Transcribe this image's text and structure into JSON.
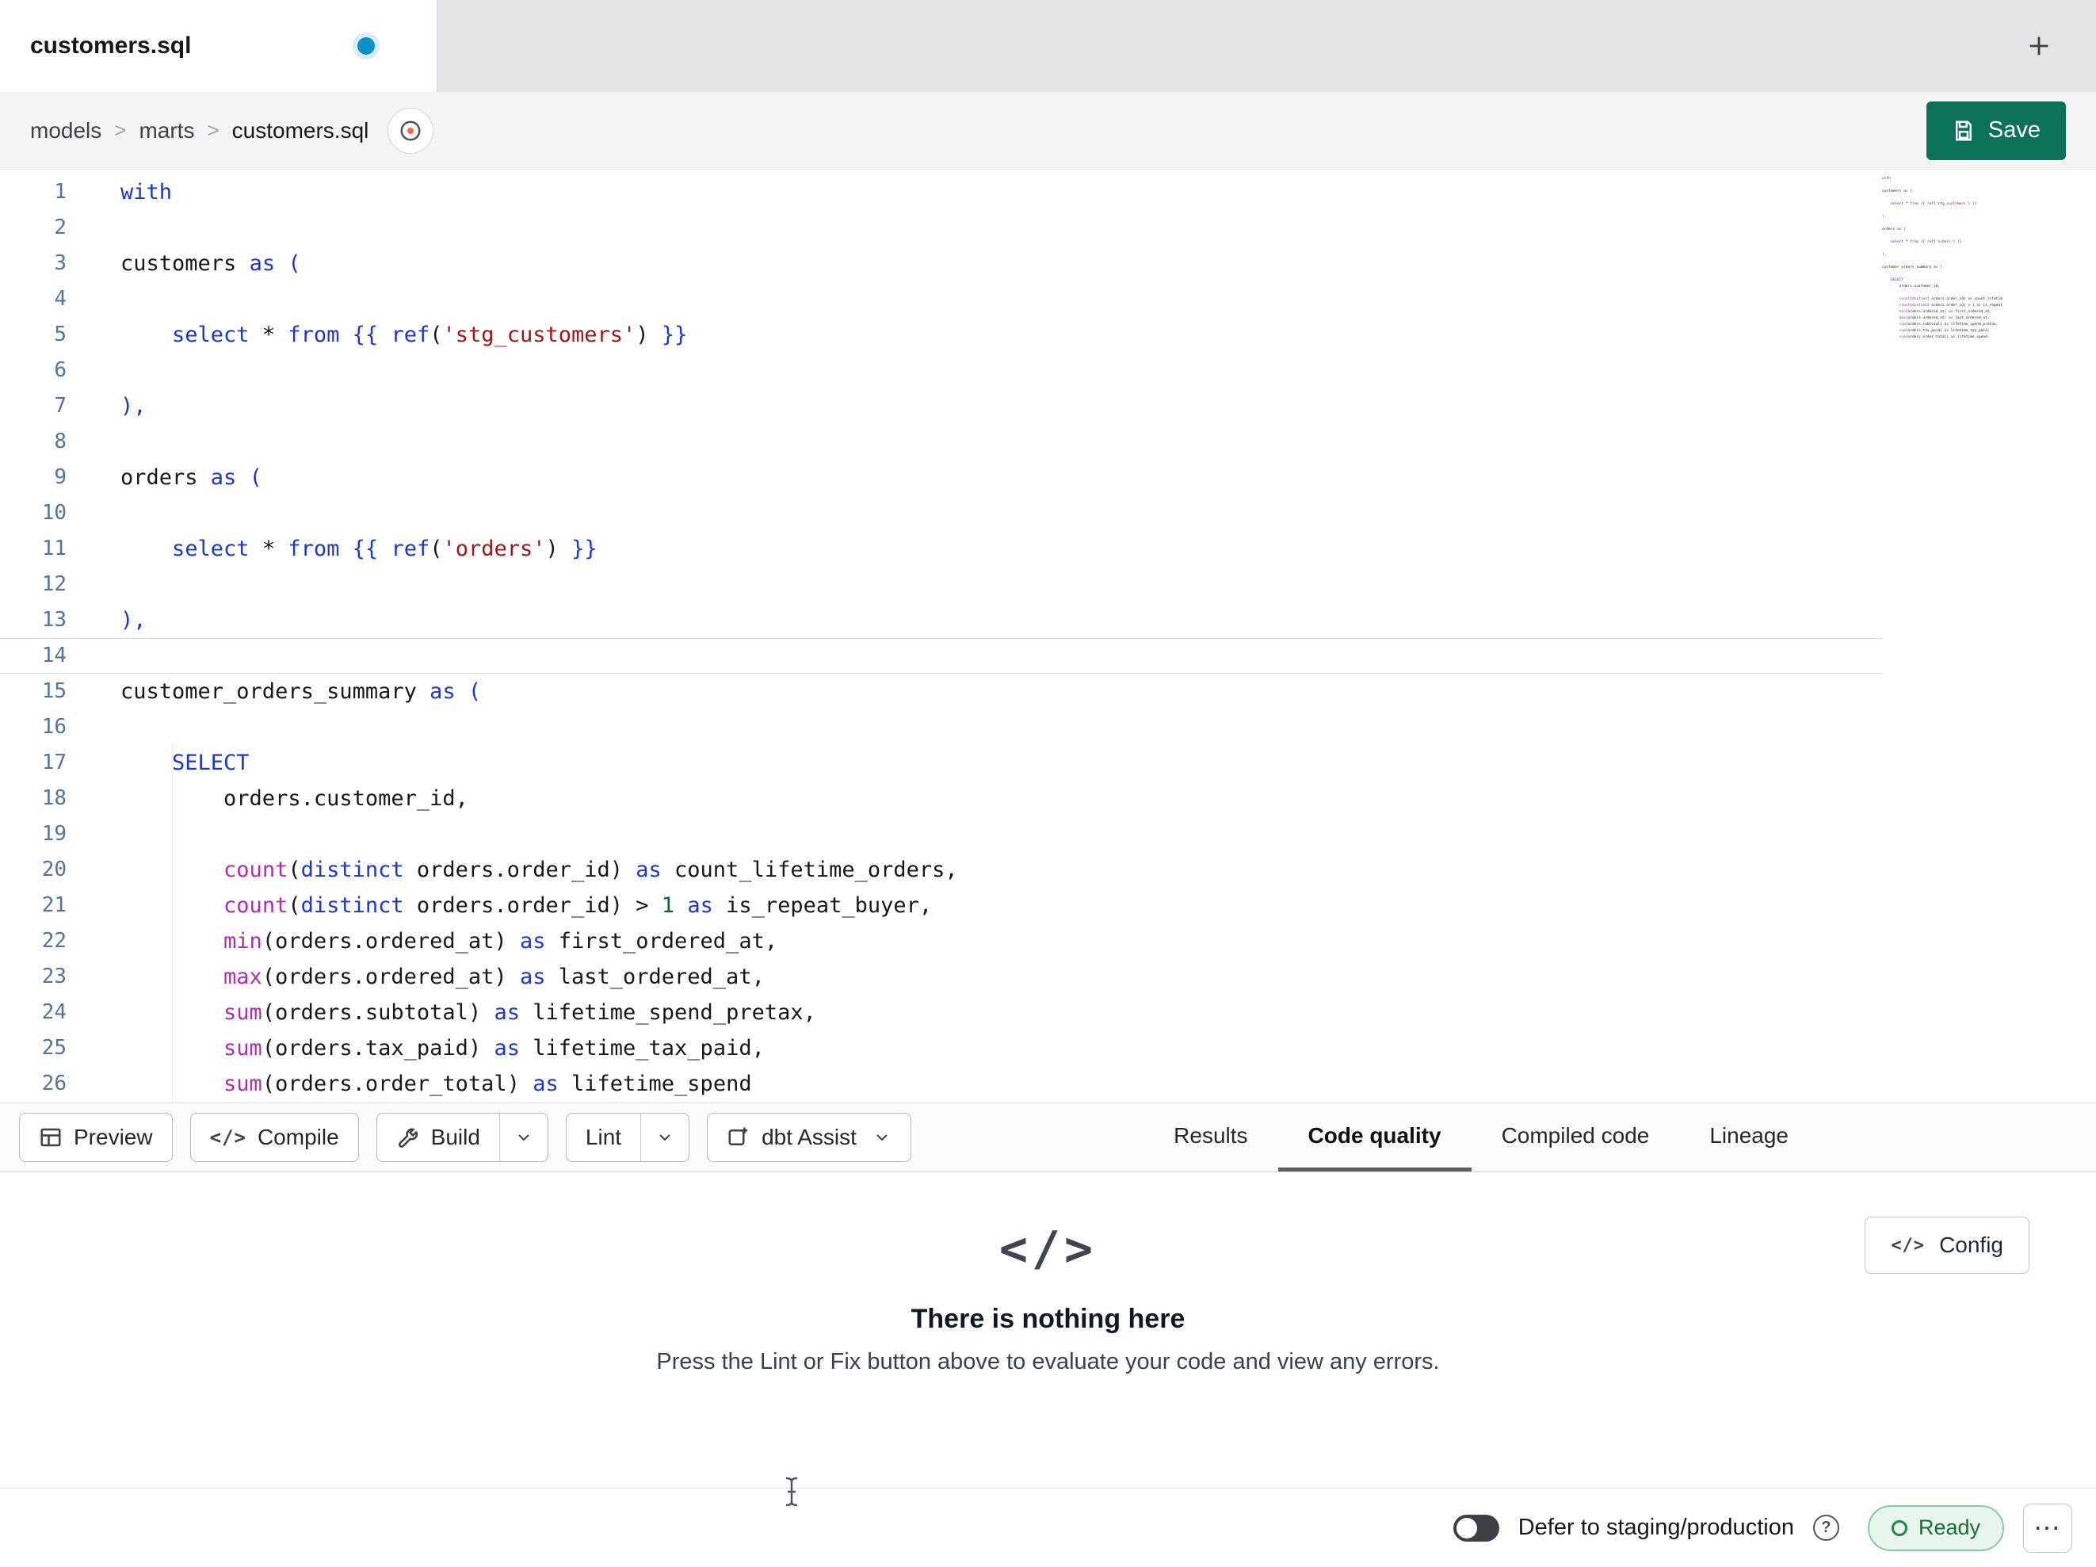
{
  "window": {
    "tab_title": "customers.sql",
    "tab_modified": true,
    "new_tab_icon": "plus-icon"
  },
  "breadcrumb": {
    "items": [
      "models",
      "marts",
      "customers.sql"
    ],
    "separator": ">",
    "docs_icon": "docs-circle-icon"
  },
  "save": {
    "label": "Save",
    "icon": "save-floppy-icon",
    "color": "#0b7258"
  },
  "editor": {
    "language": "sql",
    "current_line": 14,
    "lines": [
      {
        "num": 1,
        "tokens": [
          [
            "kw",
            "with"
          ]
        ]
      },
      {
        "num": 2,
        "tokens": []
      },
      {
        "num": 3,
        "tokens": [
          [
            "id",
            "customers "
          ],
          [
            "kw",
            "as"
          ],
          [
            "id",
            " "
          ],
          [
            "brk",
            "("
          ]
        ]
      },
      {
        "num": 4,
        "tokens": []
      },
      {
        "num": 5,
        "tokens": [
          [
            "id",
            "    "
          ],
          [
            "kw",
            "select"
          ],
          [
            "id",
            " * "
          ],
          [
            "kw",
            "from"
          ],
          [
            "id",
            " "
          ],
          [
            "tmpl",
            "{{"
          ],
          [
            "id",
            " "
          ],
          [
            "kw",
            "ref"
          ],
          [
            "punc",
            "("
          ],
          [
            "str",
            "'stg_customers'"
          ],
          [
            "punc",
            ")"
          ],
          [
            "id",
            " "
          ],
          [
            "tmpl",
            "}}"
          ]
        ]
      },
      {
        "num": 6,
        "tokens": []
      },
      {
        "num": 7,
        "tokens": [
          [
            "brk",
            "),"
          ]
        ]
      },
      {
        "num": 8,
        "tokens": []
      },
      {
        "num": 9,
        "tokens": [
          [
            "id",
            "orders "
          ],
          [
            "kw",
            "as"
          ],
          [
            "id",
            " "
          ],
          [
            "brk",
            "("
          ]
        ]
      },
      {
        "num": 10,
        "tokens": []
      },
      {
        "num": 11,
        "tokens": [
          [
            "id",
            "    "
          ],
          [
            "kw",
            "select"
          ],
          [
            "id",
            " * "
          ],
          [
            "kw",
            "from"
          ],
          [
            "id",
            " "
          ],
          [
            "tmpl",
            "{{"
          ],
          [
            "id",
            " "
          ],
          [
            "kw",
            "ref"
          ],
          [
            "punc",
            "("
          ],
          [
            "str",
            "'orders'"
          ],
          [
            "punc",
            ")"
          ],
          [
            "id",
            " "
          ],
          [
            "tmpl",
            "}}"
          ]
        ]
      },
      {
        "num": 12,
        "tokens": []
      },
      {
        "num": 13,
        "tokens": [
          [
            "brk",
            "),"
          ]
        ]
      },
      {
        "num": 14,
        "tokens": []
      },
      {
        "num": 15,
        "tokens": [
          [
            "id",
            "customer_orders_summary "
          ],
          [
            "kw",
            "as"
          ],
          [
            "id",
            " "
          ],
          [
            "brk",
            "("
          ]
        ]
      },
      {
        "num": 16,
        "tokens": []
      },
      {
        "num": 17,
        "tokens": [
          [
            "id",
            "    "
          ],
          [
            "kw",
            "SELECT"
          ]
        ]
      },
      {
        "num": 18,
        "tokens": [
          [
            "id",
            "        orders.customer_id,"
          ]
        ]
      },
      {
        "num": 19,
        "tokens": []
      },
      {
        "num": 20,
        "tokens": [
          [
            "id",
            "        "
          ],
          [
            "fn",
            "count"
          ],
          [
            "punc",
            "("
          ],
          [
            "kw",
            "distinct"
          ],
          [
            "id",
            " orders.order_id"
          ],
          [
            "punc",
            ")"
          ],
          [
            "id",
            " "
          ],
          [
            "kw",
            "as"
          ],
          [
            "id",
            " count_lifetime_orders,"
          ]
        ]
      },
      {
        "num": 21,
        "tokens": [
          [
            "id",
            "        "
          ],
          [
            "fn",
            "count"
          ],
          [
            "punc",
            "("
          ],
          [
            "kw",
            "distinct"
          ],
          [
            "id",
            " orders.order_id"
          ],
          [
            "punc",
            ")"
          ],
          [
            "id",
            " > "
          ],
          [
            "num",
            "1"
          ],
          [
            "id",
            " "
          ],
          [
            "kw",
            "as"
          ],
          [
            "id",
            " is_repeat_buyer,"
          ]
        ]
      },
      {
        "num": 22,
        "tokens": [
          [
            "id",
            "        "
          ],
          [
            "fn",
            "min"
          ],
          [
            "punc",
            "("
          ],
          [
            "id",
            "orders.ordered_at"
          ],
          [
            "punc",
            ")"
          ],
          [
            "id",
            " "
          ],
          [
            "kw",
            "as"
          ],
          [
            "id",
            " first_ordered_at,"
          ]
        ]
      },
      {
        "num": 23,
        "tokens": [
          [
            "id",
            "        "
          ],
          [
            "fn",
            "max"
          ],
          [
            "punc",
            "("
          ],
          [
            "id",
            "orders.ordered_at"
          ],
          [
            "punc",
            ")"
          ],
          [
            "id",
            " "
          ],
          [
            "kw",
            "as"
          ],
          [
            "id",
            " last_ordered_at,"
          ]
        ]
      },
      {
        "num": 24,
        "tokens": [
          [
            "id",
            "        "
          ],
          [
            "fn",
            "sum"
          ],
          [
            "punc",
            "("
          ],
          [
            "id",
            "orders.subtotal"
          ],
          [
            "punc",
            ")"
          ],
          [
            "id",
            " "
          ],
          [
            "kw",
            "as"
          ],
          [
            "id",
            " lifetime_spend_pretax,"
          ]
        ]
      },
      {
        "num": 25,
        "tokens": [
          [
            "id",
            "        "
          ],
          [
            "fn",
            "sum"
          ],
          [
            "punc",
            "("
          ],
          [
            "id",
            "orders.tax_paid"
          ],
          [
            "punc",
            ")"
          ],
          [
            "id",
            " "
          ],
          [
            "kw",
            "as"
          ],
          [
            "id",
            " lifetime_tax_paid,"
          ]
        ]
      },
      {
        "num": 26,
        "tokens": [
          [
            "id",
            "        "
          ],
          [
            "fn",
            "sum"
          ],
          [
            "punc",
            "("
          ],
          [
            "id",
            "orders.order_total"
          ],
          [
            "punc",
            ")"
          ],
          [
            "id",
            " "
          ],
          [
            "kw",
            "as"
          ],
          [
            "id",
            " lifetime_spend"
          ]
        ]
      }
    ]
  },
  "toolbar": {
    "preview": "Preview",
    "compile": "Compile",
    "build": "Build",
    "lint": "Lint",
    "assist": "dbt Assist",
    "icons": {
      "preview": "table-icon",
      "compile": "code-icon",
      "build": "wrench-icon",
      "assist": "assist-sparkle-icon",
      "dropdown": "chevron-down-icon"
    }
  },
  "panel_tabs": {
    "items": [
      "Results",
      "Code quality",
      "Compiled code",
      "Lineage"
    ],
    "active": "Code quality"
  },
  "empty_state": {
    "icon_glyph": "</>",
    "title": "There is nothing here",
    "subtitle": "Press the Lint or Fix button above to evaluate your code and view any errors.",
    "config_label": "Config",
    "config_icon_glyph": "</>"
  },
  "status_bar": {
    "defer_label": "Defer to staging/production",
    "defer_toggle_on": false,
    "help_glyph": "?",
    "ready_label": "Ready",
    "more_glyph": "⋯",
    "ready_color": "#166f38"
  }
}
